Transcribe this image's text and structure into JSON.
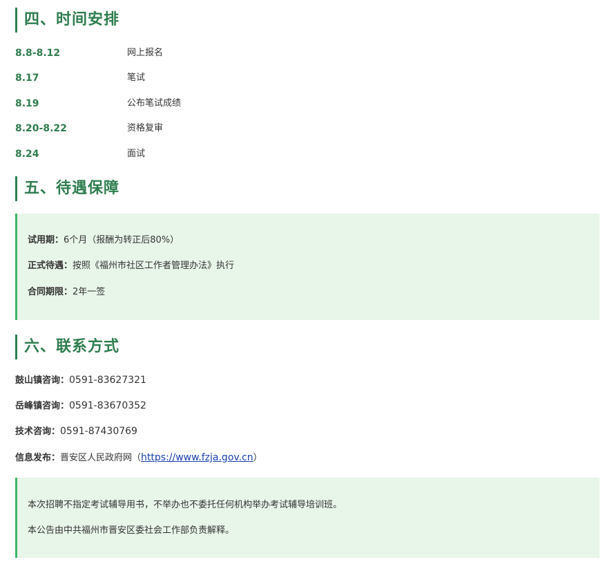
{
  "sections": {
    "schedule": {
      "title": "四、时间安排",
      "rows": [
        {
          "date": "8.8-8.12",
          "event": "网上报名"
        },
        {
          "date": "8.17",
          "event": "笔试"
        },
        {
          "date": "8.19",
          "event": "公布笔试成绩"
        },
        {
          "date": "8.20-8.22",
          "event": "资格复审"
        },
        {
          "date": "8.24",
          "event": "面试"
        }
      ]
    },
    "benefits": {
      "title": "五、待遇保障",
      "items": [
        {
          "label": "试用期：",
          "value": "6个月（报酬为转正后80%）"
        },
        {
          "label": "正式待遇：",
          "value": "按照《福州市社区工作者管理办法》执行"
        },
        {
          "label": "合同期限：",
          "value": "2年一签"
        }
      ]
    },
    "contact": {
      "title": "六、联系方式",
      "items": [
        {
          "label": "鼓山镇咨询：",
          "value": "0591-83627321"
        },
        {
          "label": "岳峰镇咨询：",
          "value": "0591-83670352"
        },
        {
          "label": "技术咨询：",
          "value": "0591-87430769"
        }
      ],
      "publish": {
        "label": "信息发布：",
        "prefix": "晋安区人民政府网（",
        "link": "https://www.fzja.gov.cn",
        "suffix": "）"
      }
    }
  },
  "notes": [
    "本次招聘不指定考试辅导用书，不举办也不委托任何机构举办考试辅导培训班。",
    "本公告由中共福州市晋安区委社会工作部负责解释。"
  ],
  "colors": {
    "accent": "#2e7d4f",
    "box_bg": "#e8f5e9",
    "box_border": "#3fb46a",
    "link": "#1a3fb0"
  }
}
